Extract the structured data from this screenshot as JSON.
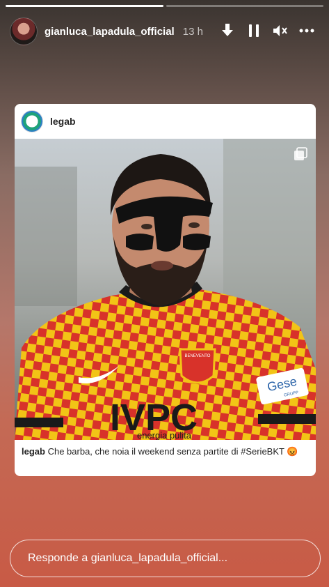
{
  "story": {
    "progress": [
      1.0,
      0.0
    ],
    "username": "gianluca_lapadula_official",
    "time": "13 h"
  },
  "controls": {
    "icons": [
      "download-icon",
      "pause-icon",
      "mute-icon",
      "more-icon"
    ]
  },
  "post": {
    "account": "legab",
    "caption_user": "legab",
    "caption_text": "Che barba, che noia il weekend senza partite di #SerieBKT 😡",
    "jersey_text": "IVPC",
    "jersey_sub": "energia pulita",
    "sponsor_text": "Gese",
    "sponsor_sub": "GRUPP",
    "badge_text": "BENEVENTO"
  },
  "reply": {
    "placeholder": "Responde a gianluca_lapadula_official..."
  },
  "colors": {
    "jersey_red": "#d8322a",
    "jersey_yellow": "#f2c416"
  }
}
